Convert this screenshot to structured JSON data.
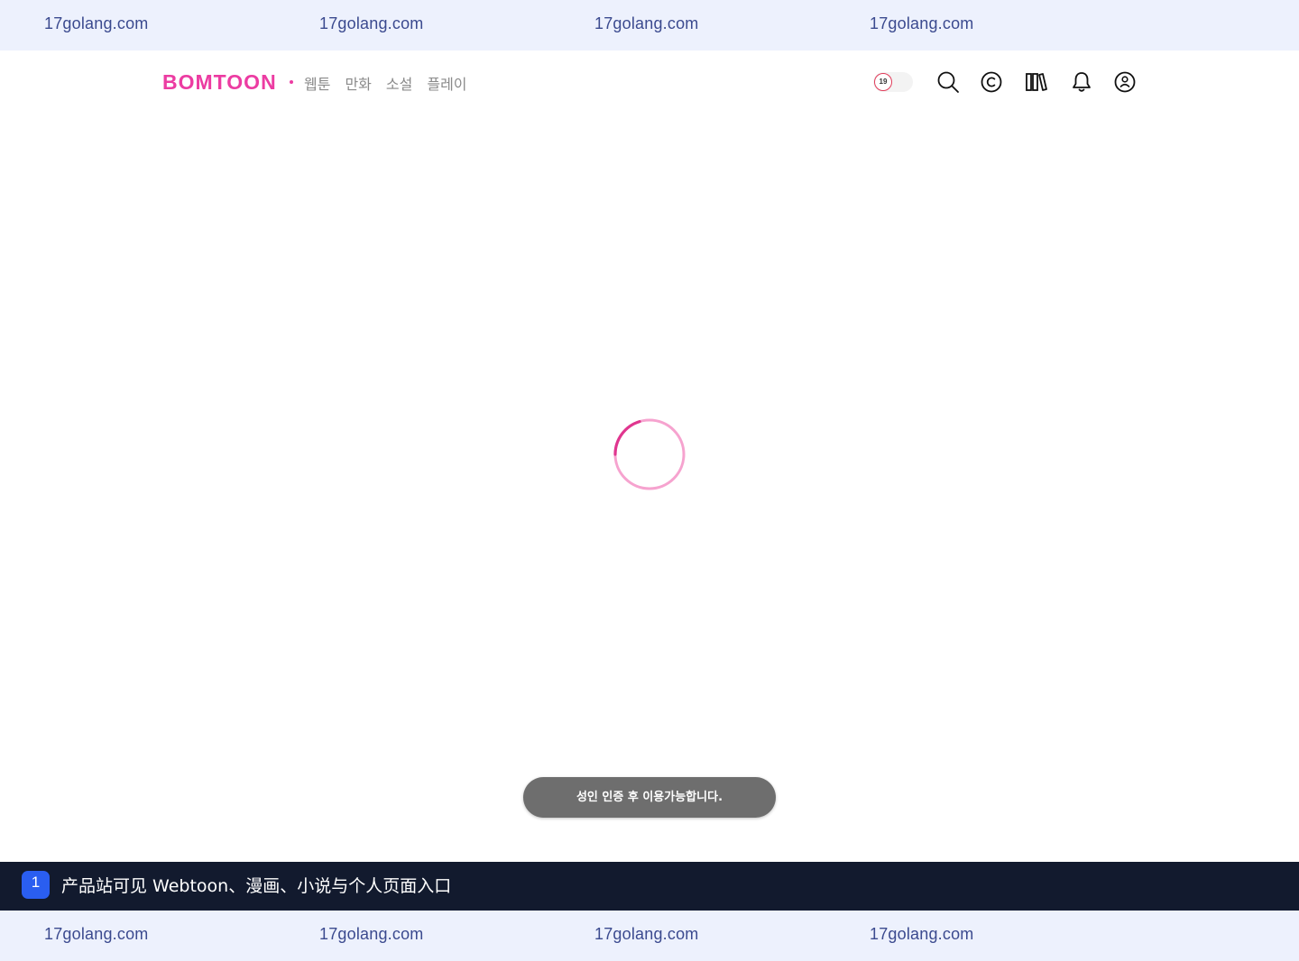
{
  "watermark": {
    "text": "17golang.com",
    "top_items": [
      "17golang.com",
      "17golang.com",
      "17golang.com",
      "17golang.com"
    ],
    "bottom_items": [
      "17golang.com",
      "17golang.com",
      "17golang.com",
      "17golang.com"
    ]
  },
  "header": {
    "logo": "BOMTOON",
    "menu": [
      "웹툰",
      "만화",
      "소설",
      "플레이"
    ],
    "adult_badge": "19",
    "adult_toggle_on": false,
    "icons": [
      "search-icon",
      "coin-icon",
      "library-icon",
      "bell-icon",
      "profile-icon"
    ]
  },
  "main": {
    "loading": true
  },
  "toast": {
    "message": "성인 인증 후 이용가능합니다."
  },
  "caption": {
    "number": "1",
    "text": "产品站可见 Webtoon、漫画、小说与个人页面入口"
  },
  "colors": {
    "brand": "#ec3ca2",
    "watermark_bg": "#edf1fd",
    "watermark_text": "#3b4a8f",
    "caption_bg": "#121a2e",
    "caption_badge": "#2a5ef0",
    "toast_bg": "#6e6e6e"
  }
}
